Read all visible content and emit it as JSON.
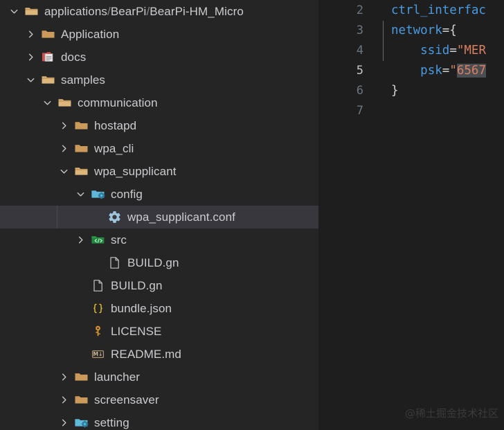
{
  "sidebar": {
    "tree": [
      {
        "label": "applications",
        "sep1": "/",
        "label2": "BearPi",
        "sep2": "/",
        "label3": "BearPi-HM_Micro",
        "indent": 1,
        "twisty": "chevron-down",
        "icon": "folder-open",
        "kind": "folder-root",
        "selected": false
      },
      {
        "label": "Application",
        "indent": 2,
        "twisty": "chevron-right",
        "icon": "folder-closed",
        "kind": "folder",
        "selected": false
      },
      {
        "label": "docs",
        "indent": 2,
        "twisty": "chevron-right",
        "icon": "docs-folder",
        "kind": "folder-docs",
        "selected": false
      },
      {
        "label": "samples",
        "indent": 2,
        "twisty": "chevron-down",
        "icon": "folder-open",
        "kind": "folder",
        "selected": false
      },
      {
        "label": "communication",
        "indent": 3,
        "twisty": "chevron-down",
        "icon": "folder-open",
        "kind": "folder",
        "selected": false
      },
      {
        "label": "hostapd",
        "indent": 4,
        "twisty": "chevron-right",
        "icon": "folder-closed",
        "kind": "folder",
        "selected": false
      },
      {
        "label": "wpa_cli",
        "indent": 4,
        "twisty": "chevron-right",
        "icon": "folder-closed",
        "kind": "folder",
        "selected": false
      },
      {
        "label": "wpa_supplicant",
        "indent": 4,
        "twisty": "chevron-down",
        "icon": "folder-open",
        "kind": "folder",
        "selected": false
      },
      {
        "label": "config",
        "indent": 5,
        "twisty": "chevron-down",
        "icon": "folder-config",
        "kind": "folder-config",
        "selected": false
      },
      {
        "label": "wpa_supplicant.conf",
        "indent": 6,
        "twisty": "none",
        "icon": "gear-icon",
        "kind": "file-conf",
        "selected": true
      },
      {
        "label": "src",
        "indent": 5,
        "twisty": "chevron-right",
        "icon": "folder-src",
        "kind": "folder-src",
        "selected": false
      },
      {
        "label": "BUILD.gn",
        "indent": 6,
        "twisty": "none",
        "icon": "file-blank",
        "kind": "file",
        "selected": false
      },
      {
        "label": "BUILD.gn",
        "indent": 5,
        "twisty": "none",
        "icon": "file-blank",
        "kind": "file",
        "selected": false
      },
      {
        "label": "bundle.json",
        "indent": 5,
        "twisty": "none",
        "icon": "json-braces",
        "kind": "file-json",
        "selected": false
      },
      {
        "label": "LICENSE",
        "indent": 5,
        "twisty": "none",
        "icon": "key-icon",
        "kind": "file-license",
        "selected": false
      },
      {
        "label": "README.md",
        "indent": 5,
        "twisty": "none",
        "icon": "markdown-badge",
        "kind": "file-markdown",
        "selected": false
      },
      {
        "label": "launcher",
        "indent": 4,
        "twisty": "chevron-right",
        "icon": "folder-closed",
        "kind": "folder",
        "selected": false
      },
      {
        "label": "screensaver",
        "indent": 4,
        "twisty": "chevron-right",
        "icon": "folder-closed",
        "kind": "folder",
        "selected": false
      },
      {
        "label": "setting",
        "indent": 4,
        "twisty": "chevron-right",
        "icon": "folder-config",
        "kind": "folder-config",
        "selected": false
      }
    ]
  },
  "editor": {
    "lines": [
      {
        "num": "2",
        "active": false,
        "segments": [
          {
            "t": "ctrl_interfac",
            "c": "id"
          }
        ]
      },
      {
        "num": "3",
        "active": false,
        "segments": [
          {
            "t": "network",
            "c": "id"
          },
          {
            "t": "={",
            "c": "punc"
          }
        ]
      },
      {
        "num": "4",
        "active": false,
        "segments": [
          {
            "t": "    ",
            "c": "punc"
          },
          {
            "t": "ssid",
            "c": "id"
          },
          {
            "t": "=",
            "c": "punc"
          },
          {
            "t": "\"MER",
            "c": "str"
          }
        ]
      },
      {
        "num": "5",
        "active": true,
        "segments": [
          {
            "t": "    ",
            "c": "punc"
          },
          {
            "t": "psk",
            "c": "id"
          },
          {
            "t": "=",
            "c": "punc"
          },
          {
            "t": "\"",
            "c": "str"
          },
          {
            "t": "6567",
            "c": "str",
            "sel": true
          }
        ]
      },
      {
        "num": "6",
        "active": false,
        "segments": [
          {
            "t": "}",
            "c": "punc"
          }
        ]
      },
      {
        "num": "7",
        "active": false,
        "segments": []
      }
    ]
  },
  "watermark": {
    "text": "@稀土掘金技术社区"
  },
  "colors": {
    "sidebar_bg": "#252526",
    "editor_bg": "#1e1e1e",
    "selection_row": "#37373d",
    "folder": "#cb9a5b",
    "text": "#ccccd0",
    "string": "#d98060",
    "identifier": "#4a9ae0",
    "line_number": "#6e7681"
  }
}
